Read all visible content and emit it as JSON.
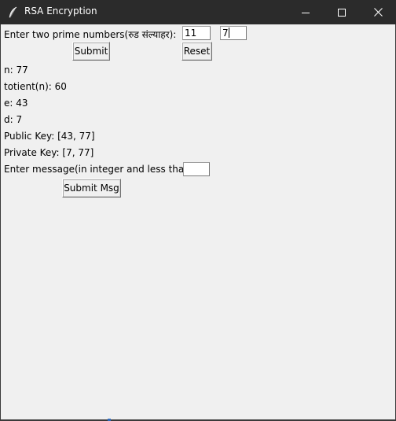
{
  "window": {
    "title": "RSA Encryption",
    "icons": {
      "app": "feather-icon",
      "minimize": "minimize-icon",
      "maximize": "maximize-icon",
      "close": "close-icon"
    }
  },
  "form": {
    "primes_label": "Enter two prime numbers(रुड संल्याहर):",
    "prime1_value": "11",
    "prime2_value": "7",
    "submit_label": "Submit",
    "reset_label": "Reset"
  },
  "results": {
    "n": "n: 77",
    "totient": "totient(n): 60",
    "e": "e: 43",
    "d": "d: 7",
    "public_key": "Public Key: [43, 77]",
    "private_key": "Private Key: [7, 77]"
  },
  "message": {
    "label": "Enter message(in integer and less than n):",
    "value": "",
    "submit_label": "Submit Msg"
  }
}
